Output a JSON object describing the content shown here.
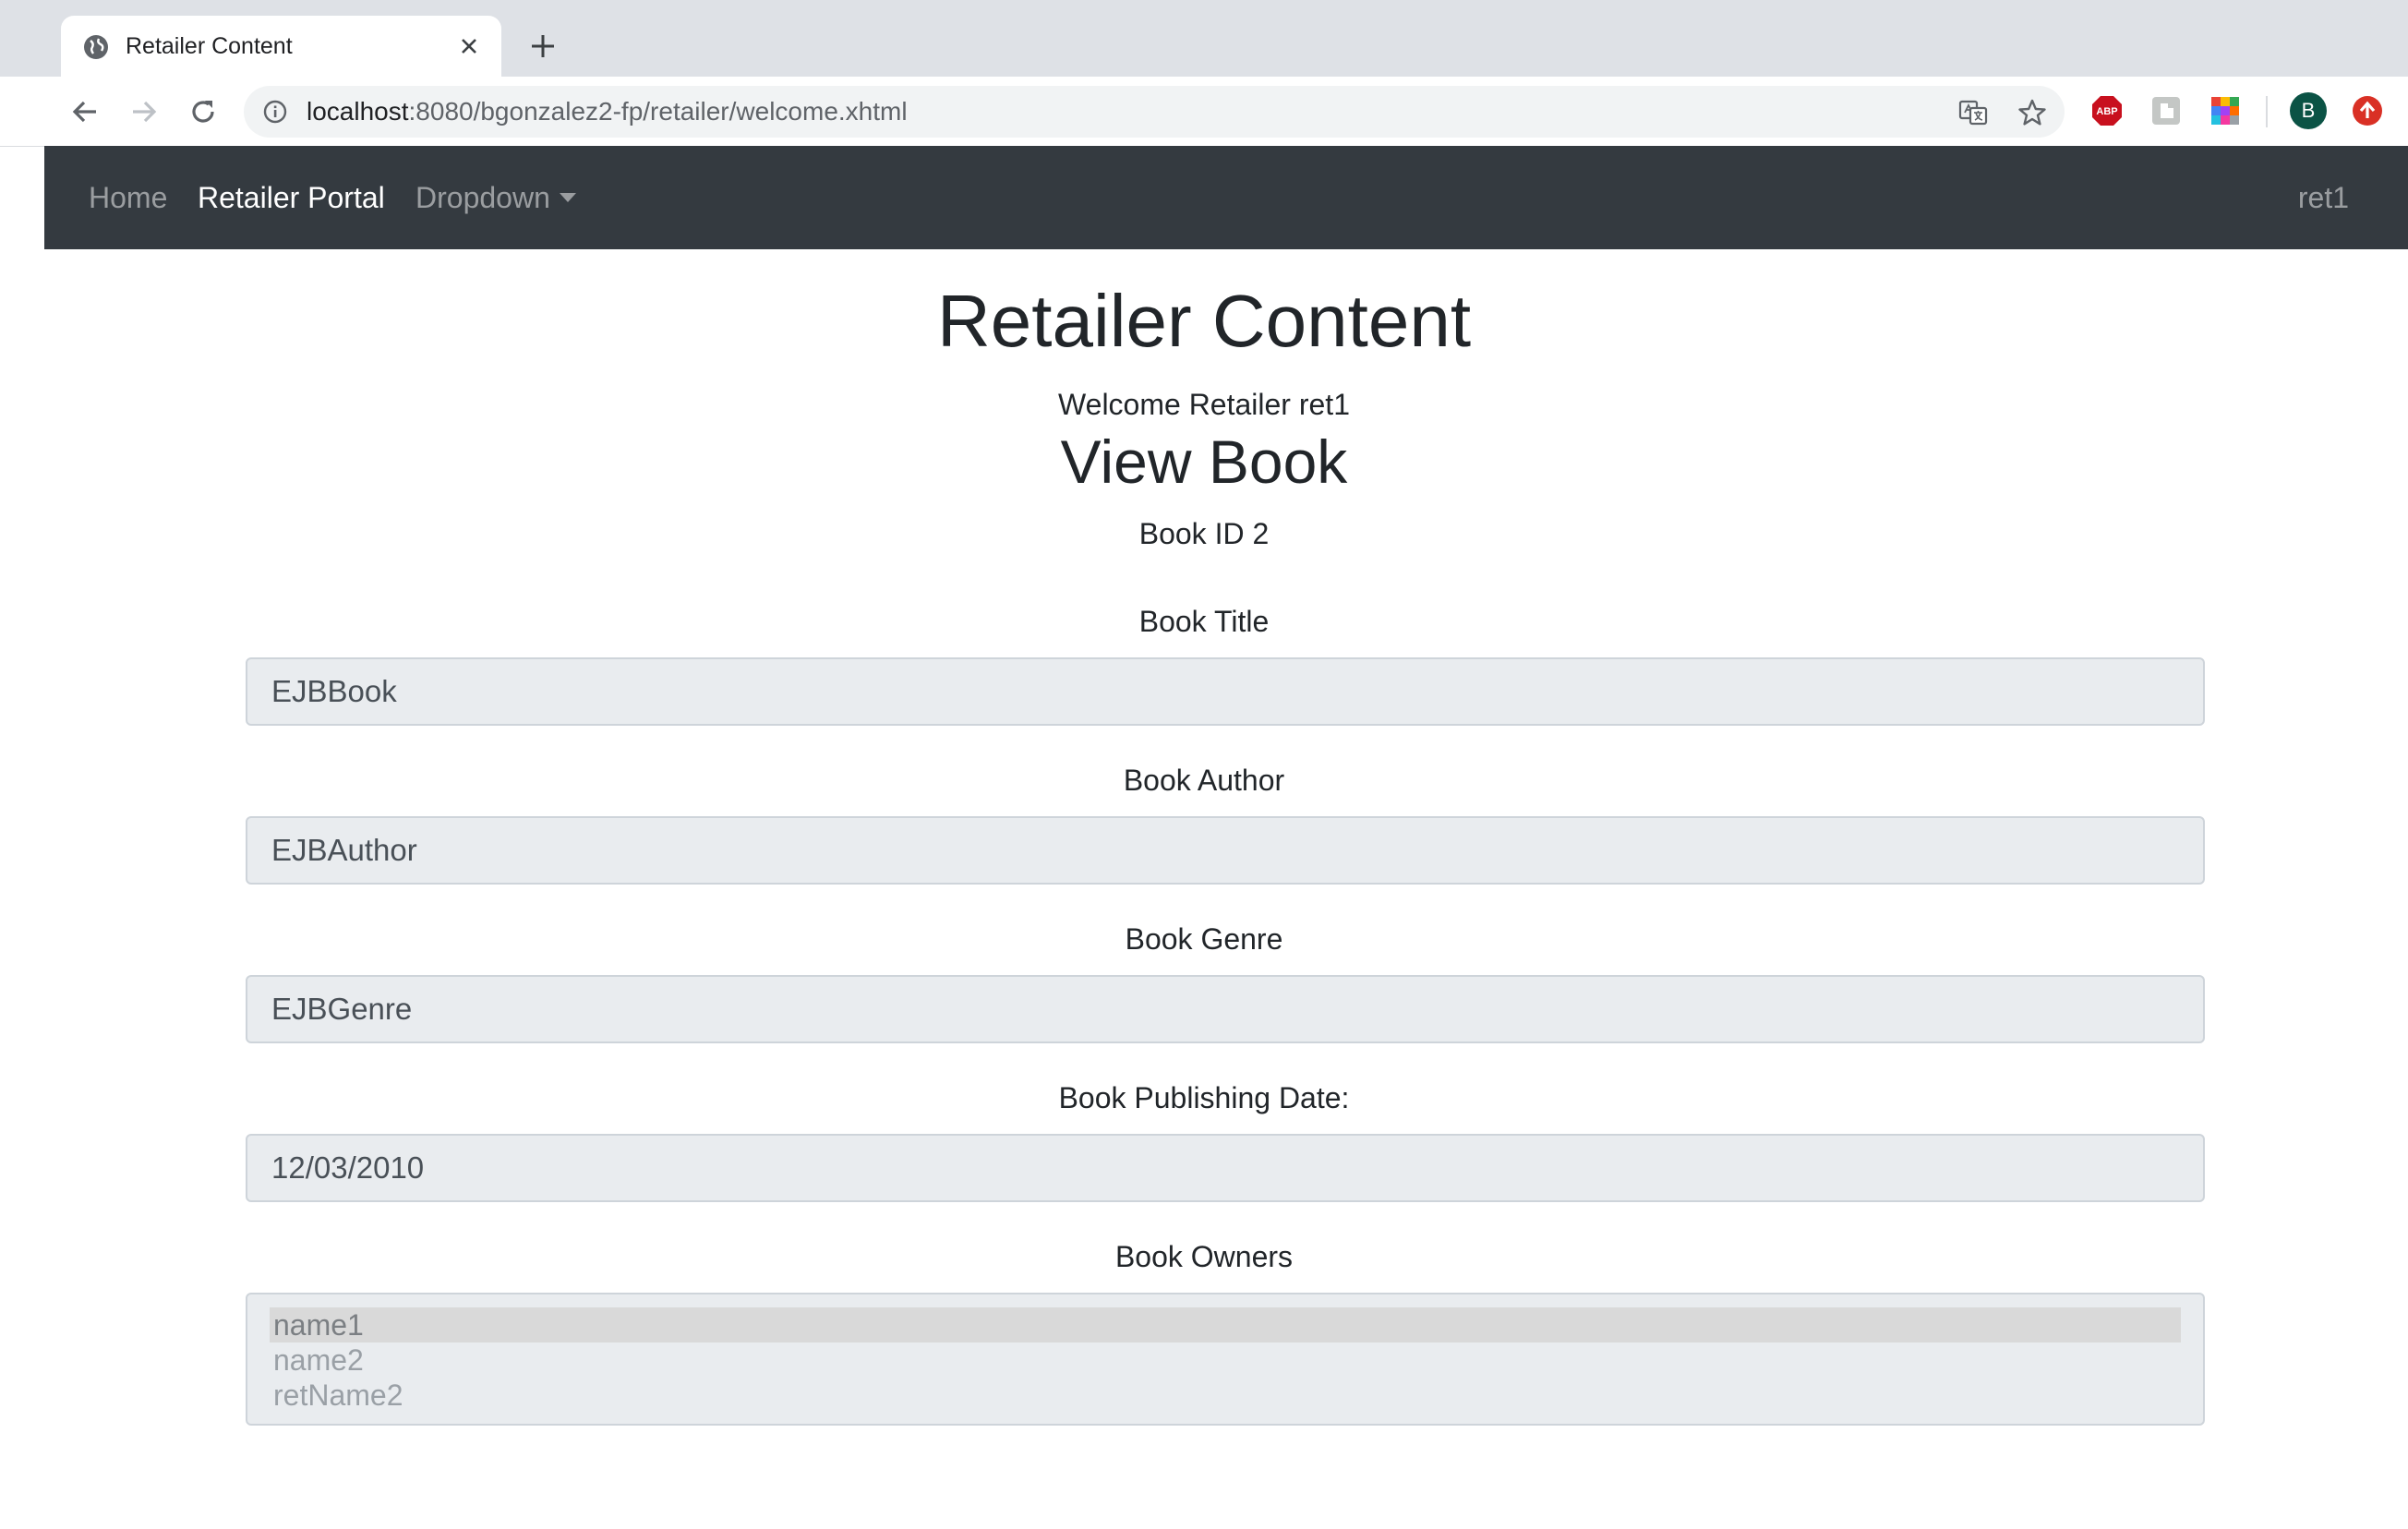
{
  "browser": {
    "tab_title": "Retailer Content",
    "url_host": "localhost",
    "url_path": ":8080/bgonzalez2-fp/retailer/welcome.xhtml",
    "profile_initial": "B",
    "extensions": [
      "abp-icon",
      "puzzle-extension-icon",
      "color-grid-extension-icon"
    ]
  },
  "navbar": {
    "links": [
      {
        "label": "Home",
        "active": false
      },
      {
        "label": "Retailer Portal",
        "active": true
      },
      {
        "label": "Dropdown",
        "active": false
      }
    ],
    "user": "ret1",
    "background": "#343a40"
  },
  "content": {
    "title": "Retailer Content",
    "welcome": "Welcome Retailer ret1",
    "subtitle": "View Book",
    "book_id": "Book ID 2",
    "fields": [
      {
        "label": "Book Title",
        "value": "EJBBook"
      },
      {
        "label": "Book Author",
        "value": "EJBAuthor"
      },
      {
        "label": "Book Genre",
        "value": "EJBGenre"
      },
      {
        "label": "Book Publishing Date:",
        "value": "12/03/2010"
      }
    ],
    "owners_label": "Book Owners",
    "owners": [
      "name1",
      "name2",
      "retName2"
    ],
    "owners_selected": "name1"
  }
}
